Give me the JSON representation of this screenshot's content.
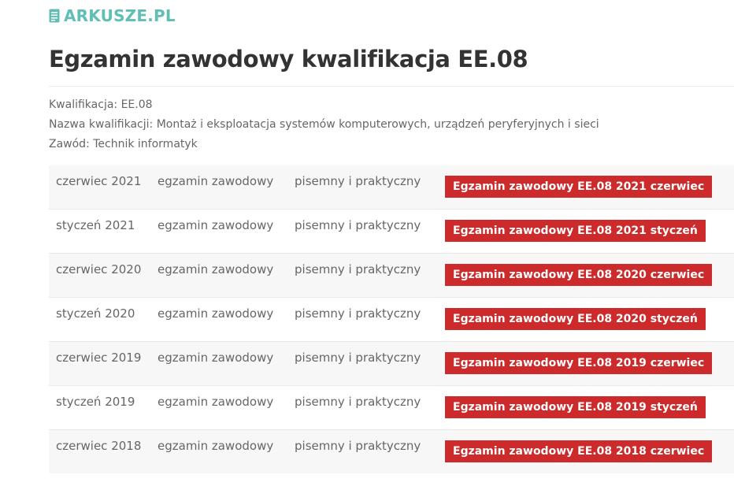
{
  "site": {
    "logo_text": "ARKUSZE.PL"
  },
  "page": {
    "title": "Egzamin zawodowy kwalifikacja EE.08"
  },
  "info": {
    "kwalifikacja": "Kwalifikacja: EE.08",
    "nazwa": "Nazwa kwalifikacji: Montaż i eksploatacja systemów komputerowych, urządzeń peryferyjnych i sieci",
    "zawod": "Zawód: Technik informatyk"
  },
  "exams": [
    {
      "date": "czerwiec 2021",
      "type": "egzamin zawodowy",
      "form": "pisemny i praktyczny",
      "link": "Egzamin zawodowy EE.08 2021 czerwiec"
    },
    {
      "date": "styczeń 2021",
      "type": "egzamin zawodowy",
      "form": "pisemny i praktyczny",
      "link": "Egzamin zawodowy EE.08 2021 styczeń"
    },
    {
      "date": "czerwiec 2020",
      "type": "egzamin zawodowy",
      "form": "pisemny i praktyczny",
      "link": "Egzamin zawodowy EE.08 2020 czerwiec"
    },
    {
      "date": "styczeń 2020",
      "type": "egzamin zawodowy",
      "form": "pisemny i praktyczny",
      "link": "Egzamin zawodowy EE.08 2020 styczeń"
    },
    {
      "date": "czerwiec 2019",
      "type": "egzamin zawodowy",
      "form": "pisemny i praktyczny",
      "link": "Egzamin zawodowy EE.08 2019 czerwiec"
    },
    {
      "date": "styczeń 2019",
      "type": "egzamin zawodowy",
      "form": "pisemny i praktyczny",
      "link": "Egzamin zawodowy EE.08 2019 styczeń"
    },
    {
      "date": "czerwiec 2018",
      "type": "egzamin zawodowy",
      "form": "pisemny i praktyczny",
      "link": "Egzamin zawodowy EE.08 2018 czerwiec"
    }
  ],
  "colors": {
    "accent": "#cd2b2b",
    "brand": "#5fbfb4",
    "title": "#333333"
  },
  "icons": {
    "logo": "document-icon"
  }
}
